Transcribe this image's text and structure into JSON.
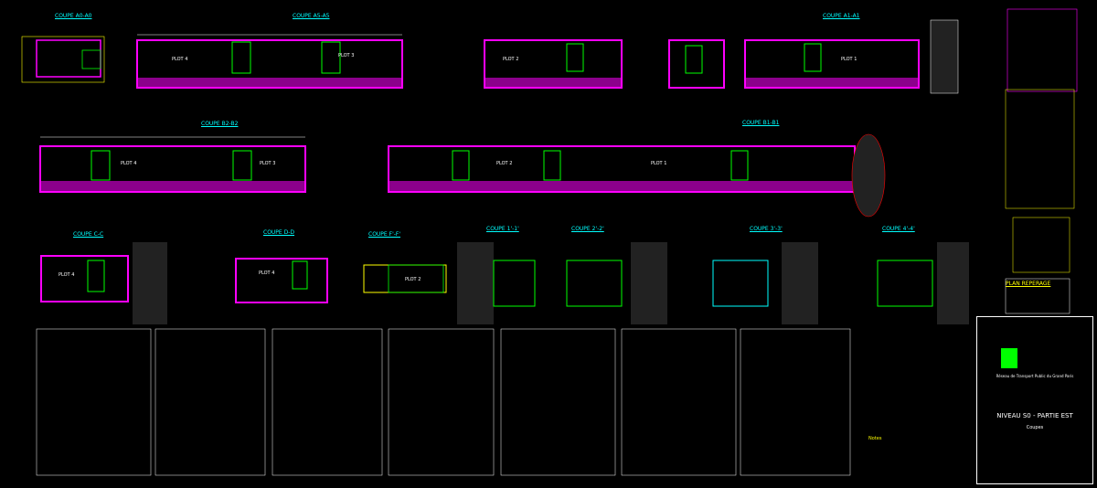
{
  "sections": {
    "coupe_a0_a0": "COUPE A0-A0",
    "coupe_a5_a5": "COUPE A5-A5",
    "coupe_a1_a1": "COUPE A1-A1",
    "coupe_b2_b2": "COUPE B2-B2",
    "coupe_b1_b1": "COUPE B1-B1",
    "coupe_c_c": "COUPE C-C",
    "coupe_d_d": "COUPE D-D",
    "coupe_f_f": "COUPE F'-F'",
    "coupe_1_1": "COUPE 1'-1'",
    "coupe_2_2": "COUPE 2'-2'",
    "coupe_3_3": "COUPE 3'-3'",
    "coupe_4_4": "COUPE 4'-4'"
  },
  "plots": {
    "plot1_a": "PLOT 1",
    "plot2_a": "PLOT 2",
    "plot3_a": "PLOT 3",
    "plot4_a": "PLOT 4",
    "plot1_b": "PLOT 1",
    "plot2_b": "PLOT 2",
    "plot3_b": "PLOT 3",
    "plot4_b": "PLOT 4",
    "plot4_c": "PLOT 4",
    "plot4_d": "PLOT 4",
    "plot2_e": "PLOT 2"
  },
  "plan_reperage": "PLAN REPERAGE",
  "title_block": {
    "project": "Réseau de Transport Public du Grand Paris",
    "level": "NIVEAU S0 - PARTIE EST",
    "sub": "Coupes"
  },
  "note": "Notes",
  "colors": {
    "magenta": "#ff00ff",
    "yellow": "#ffff00",
    "cyan": "#00ffff",
    "green": "#00ff00",
    "red": "#ff0000",
    "white": "#ffffff"
  }
}
